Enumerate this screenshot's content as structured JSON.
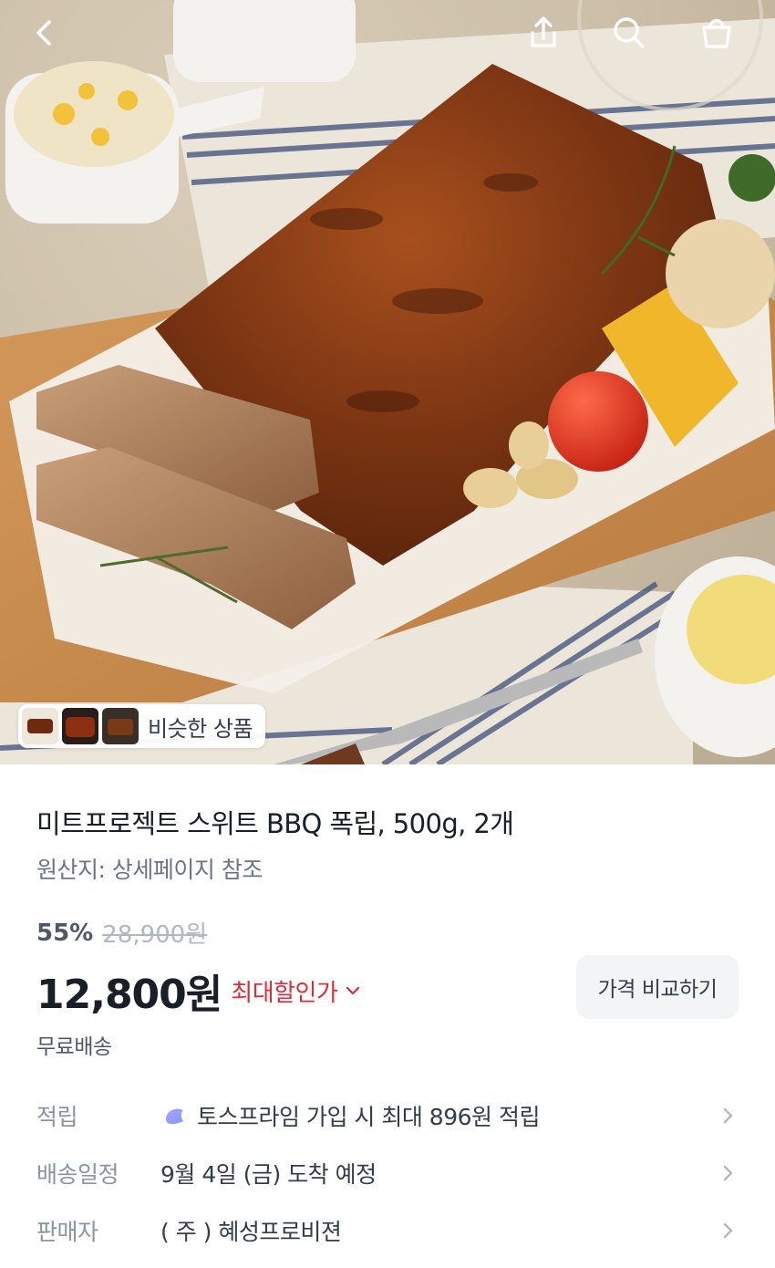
{
  "header": {
    "icons": [
      "back-icon",
      "share-icon",
      "search-icon",
      "cart-icon"
    ]
  },
  "similar": {
    "label": "비슷한 상품"
  },
  "product": {
    "title": "미트프로젝트 스위트 BBQ 폭립, 500g, 2개",
    "origin": "원산지: 상세페이지 참조",
    "discount_percent": "55%",
    "original_price": "28,900원",
    "price": "12,800원",
    "max_discount_label": "최대할인가",
    "compare_button": "가격 비교하기",
    "shipping": "무료배송"
  },
  "details": [
    {
      "label": "적립",
      "value": "토스프라임 가입 시 최대 896원 적립",
      "icon": "toss-prime-icon"
    },
    {
      "label": "배송일정",
      "value": "9월 4일 (금) 도착 예정"
    },
    {
      "label": "판매자",
      "value": "( 주 ) 혜성프로비젼"
    }
  ],
  "colors": {
    "accent_red": "#e42939",
    "text_primary": "#191f28",
    "text_secondary": "#6b7684",
    "button_bg": "#f2f4f6"
  }
}
